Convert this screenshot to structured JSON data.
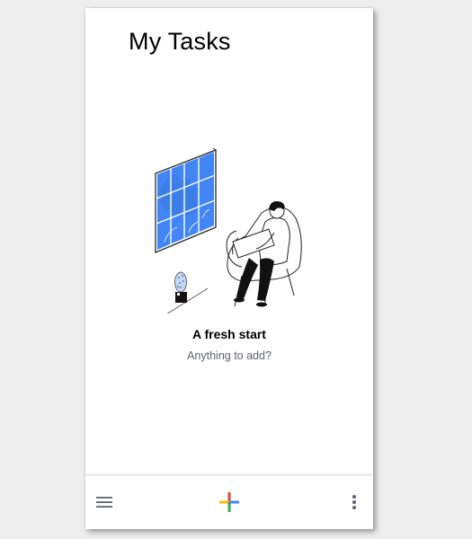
{
  "app": {
    "title": "My Tasks"
  },
  "empty_state": {
    "illustration": "person-reading-in-chair-illustration",
    "heading": "A fresh start",
    "subtitle": "Anything to add?"
  },
  "bottom_bar": {
    "menu_icon": "hamburger-menu-icon",
    "add_icon": "multicolor-plus-icon",
    "more_icon": "more-vert-icon"
  },
  "colors": {
    "accent_blue": "#4285f4",
    "plus_red": "#ea4335",
    "plus_yellow": "#fbbc05",
    "plus_green": "#34a853",
    "plus_blue": "#4285f4",
    "subtitle_gray": "#5f6368"
  }
}
